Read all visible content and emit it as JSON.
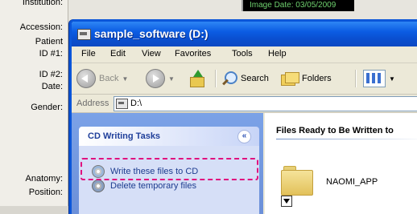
{
  "background_app": {
    "labels": [
      "Institution:",
      "Accession:",
      "Patient",
      "ID #1:",
      "ID #2:",
      "Date:",
      "Gender:",
      "Anatomy:",
      "Position:"
    ],
    "image_date": "Image Date: 03/05/2009"
  },
  "window": {
    "title": "sample_software (D:)",
    "menu": [
      "File",
      "Edit",
      "View",
      "Favorites",
      "Tools",
      "Help"
    ],
    "toolbar": {
      "back_label": "Back",
      "search_label": "Search",
      "folders_label": "Folders"
    },
    "address": {
      "label": "Address",
      "value": "D:\\"
    },
    "task_pane": {
      "title": "CD Writing Tasks",
      "items": [
        "Write these files to CD",
        "Delete temporary files"
      ]
    },
    "files_pane": {
      "heading": "Files Ready to Be Written to",
      "items": [
        {
          "name": "NAOMI_APP",
          "icon": "folder-icon"
        }
      ]
    }
  },
  "colors": {
    "titlebar": "#0b5ce3",
    "task_pane_bg": "#7ba2e7",
    "task_body": "#d6dff7",
    "highlight": "#e0127f"
  }
}
